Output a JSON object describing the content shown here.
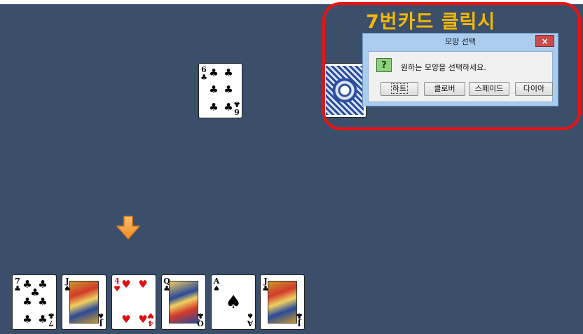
{
  "annotation": {
    "caption": "7번카드 클릭시",
    "highlight_color": "#ee1111",
    "caption_color": "#f5b800"
  },
  "table": {
    "background": "#3b4f6b"
  },
  "played_card": {
    "rank": "6",
    "suit": "♣",
    "suit_name": "clubs"
  },
  "deck": {
    "icon": "card-back-pattern"
  },
  "dialog": {
    "title": "모양 선택",
    "close_label": "×",
    "icon_label": "?",
    "message": "원하는 모양을 선택하세요.",
    "buttons": [
      "하트",
      "클로버",
      "스페이드",
      "다이아"
    ]
  },
  "turn_indicator": {
    "icon": "down-arrow-icon",
    "color": "#f3962a"
  },
  "hand": [
    {
      "rank": "7",
      "suit": "♣",
      "suit_name": "clubs"
    },
    {
      "rank": "J",
      "suit": "♠",
      "suit_name": "spades"
    },
    {
      "rank": "4",
      "suit": "♥",
      "suit_name": "hearts"
    },
    {
      "rank": "Q",
      "suit": "♣",
      "suit_name": "clubs"
    },
    {
      "rank": "A",
      "suit": "♠",
      "suit_name": "spades"
    },
    {
      "rank": "J",
      "suit": "♣",
      "suit_name": "clubs"
    }
  ]
}
